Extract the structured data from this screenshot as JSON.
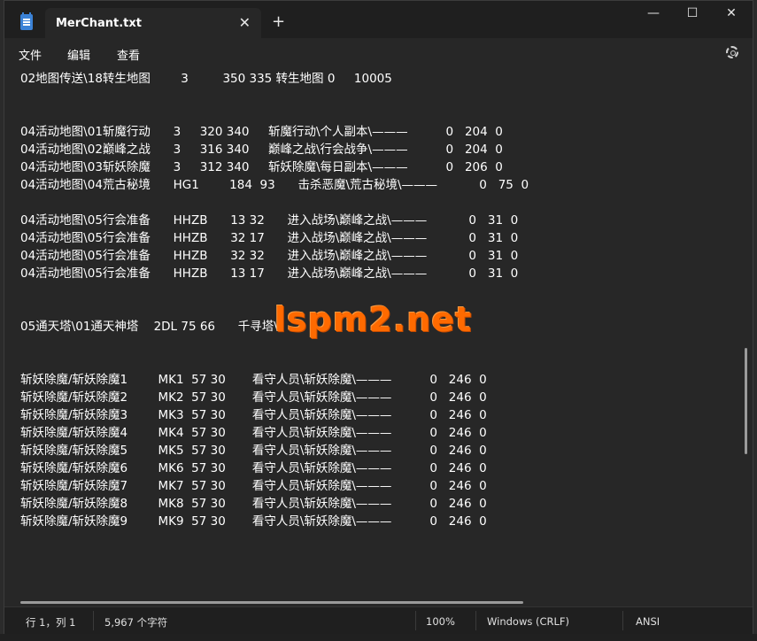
{
  "window": {
    "tab_title": "MerChant.txt",
    "tab_close_glyph": "✕",
    "new_tab_glyph": "+",
    "minimize_glyph": "—",
    "maximize_glyph": "☐",
    "close_glyph": "✕"
  },
  "menu": {
    "file": "文件",
    "edit": "编辑",
    "view": "查看",
    "settings_icon": "gear-icon"
  },
  "editor": {
    "lines": [
      "02地图传送\\18转生地图        3         350 335 转生地图 0     10005",
      "",
      "",
      "04活动地图\\01斩魔行动      3     320 340     斩魔行动\\个人副本\\———          0   204  0",
      "04活动地图\\02巅峰之战      3     316 340     巅峰之战\\行会战争\\———          0   204  0",
      "04活动地图\\03斩妖除魔      3     312 340     斩妖除魔\\每日副本\\———          0   206  0",
      "04活动地图\\04荒古秘境      HG1        184  93      击杀恶魔\\荒古秘境\\———           0   75  0",
      "",
      "04活动地图\\05行会准备      HHZB      13 32      进入战场\\巅峰之战\\———           0   31  0",
      "04活动地图\\05行会准备      HHZB      32 17      进入战场\\巅峰之战\\———           0   31  0",
      "04活动地图\\05行会准备      HHZB      32 32      进入战场\\巅峰之战\\———           0   31  0",
      "04活动地图\\05行会准备      HHZB      13 17      进入战场\\巅峰之战\\———           0   31  0",
      "",
      "",
      "05通天塔\\01通天神塔    2DL 75 66      千寻塔\\",
      "",
      "",
      "斩妖除魔/斩妖除魔1        MK1  57 30       看守人员\\斩妖除魔\\———          0   246  0",
      "斩妖除魔/斩妖除魔2        MK2  57 30       看守人员\\斩妖除魔\\———          0   246  0",
      "斩妖除魔/斩妖除魔3        MK3  57 30       看守人员\\斩妖除魔\\———          0   246  0",
      "斩妖除魔/斩妖除魔4        MK4  57 30       看守人员\\斩妖除魔\\———          0   246  0",
      "斩妖除魔/斩妖除魔5        MK5  57 30       看守人员\\斩妖除魔\\———          0   246  0",
      "斩妖除魔/斩妖除魔6        MK6  57 30       看守人员\\斩妖除魔\\———          0   246  0",
      "斩妖除魔/斩妖除魔7        MK7  57 30       看守人员\\斩妖除魔\\———          0   246  0",
      "斩妖除魔/斩妖除魔8        MK8  57 30       看守人员\\斩妖除魔\\———          0   246  0",
      "斩妖除魔/斩妖除魔9        MK9  57 30       看守人员\\斩妖除魔\\———          0   246  0"
    ],
    "watermark": "lspm2.net"
  },
  "status": {
    "position": "行 1，列 1",
    "char_count": "5,967 个字符",
    "zoom": "100%",
    "line_ending": "Windows (CRLF)",
    "encoding": "ANSI"
  },
  "colors": {
    "background": "#272727",
    "titlebar": "#1f1f1f",
    "watermark": "#ff6a00"
  }
}
